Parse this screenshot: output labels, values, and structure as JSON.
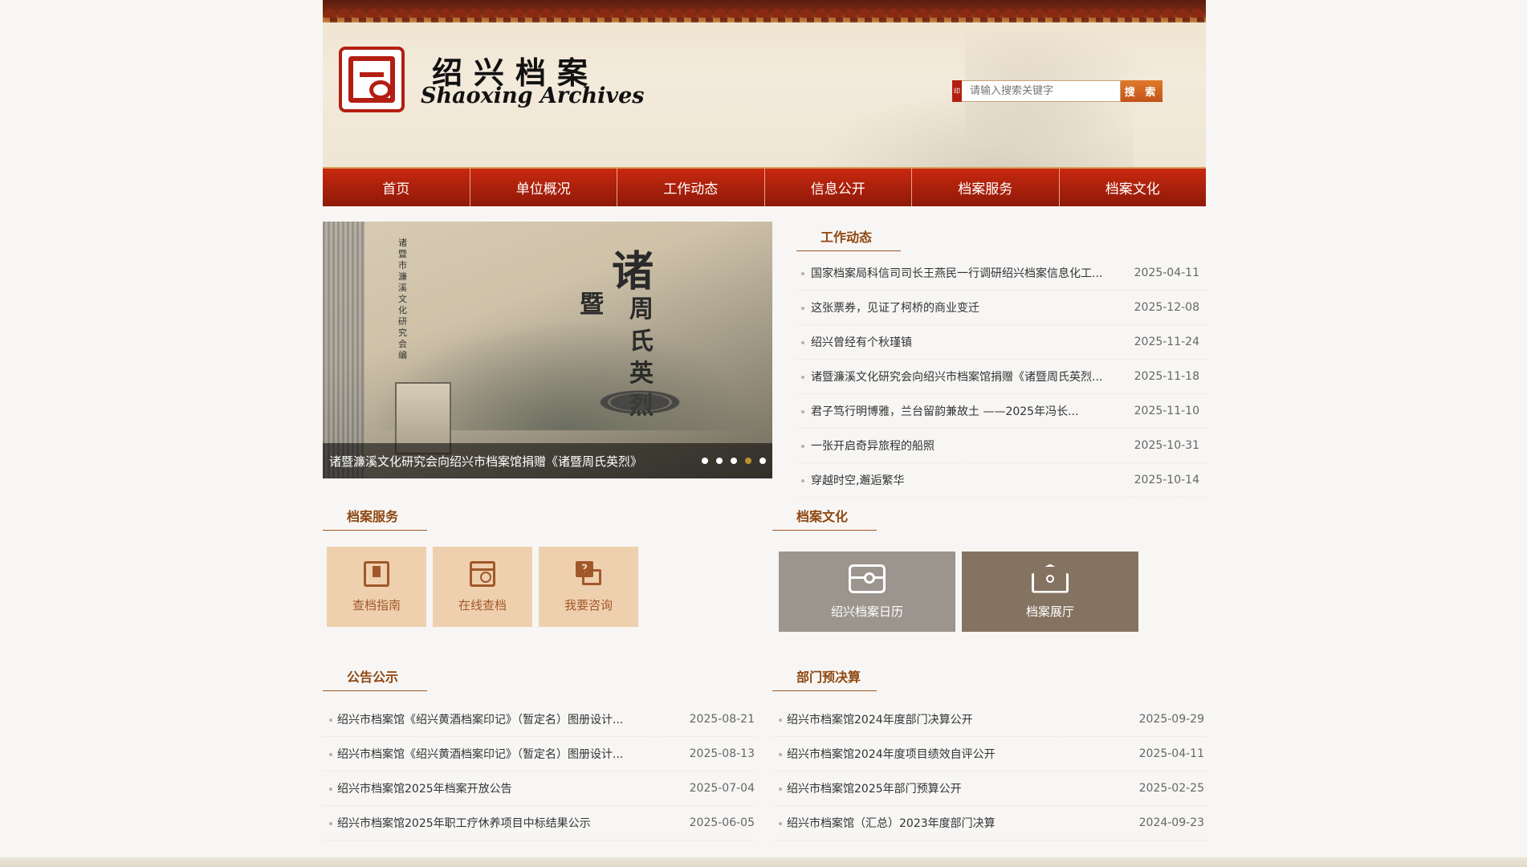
{
  "header": {
    "logo_cn": "绍兴档案",
    "logo_en": "Shaoxing Archives",
    "search_placeholder": "请输入搜索关键字",
    "search_button": "搜 索"
  },
  "nav": [
    {
      "label": "首页"
    },
    {
      "label": "单位概况"
    },
    {
      "label": "工作动态"
    },
    {
      "label": "信息公开"
    },
    {
      "label": "档案服务"
    },
    {
      "label": "档案文化"
    }
  ],
  "slider": {
    "caption": "诸暨濂溪文化研究会向绍兴市档案馆捐赠《诸暨周氏英烈》",
    "image_title_1": "诸",
    "image_title_2": "暨",
    "image_title_col": "周氏英烈",
    "image_side_text": "诸暨市濂溪文化研究会编",
    "dot_count": 5,
    "active_dot": 4
  },
  "news": {
    "title": "工作动态",
    "items": [
      {
        "title": "国家档案局科信司司长王燕民一行调研绍兴档案信息化工...",
        "date": "2025-04-11"
      },
      {
        "title": "这张票券，见证了柯桥的商业变迁",
        "date": "2025-12-08"
      },
      {
        "title": "绍兴曾经有个秋瑾镇",
        "date": "2025-11-24"
      },
      {
        "title": "诸暨濂溪文化研究会向绍兴市档案馆捐赠《诸暨周氏英烈...",
        "date": "2025-11-18"
      },
      {
        "title": "君子笃行明博雅，兰台留韵兼故土 ——2025年冯长...",
        "date": "2025-11-10"
      },
      {
        "title": "一张开启奇异旅程的船照",
        "date": "2025-10-31"
      },
      {
        "title": "穿越时空,邂逅繁华",
        "date": "2025-10-14"
      }
    ]
  },
  "services": {
    "title": "档案服务",
    "tiles": [
      {
        "label": "查档指南",
        "icon": "book-icon"
      },
      {
        "label": "在线查档",
        "icon": "calendar-search-icon"
      },
      {
        "label": "我要咨询",
        "icon": "chat-question-icon"
      }
    ]
  },
  "culture": {
    "title": "档案文化",
    "tiles": [
      {
        "label": "绍兴档案日历",
        "icon": "archive-box-icon"
      },
      {
        "label": "档案展厅",
        "icon": "tag-house-icon"
      }
    ]
  },
  "notices": {
    "title": "公告公示",
    "items": [
      {
        "title": "绍兴市档案馆《绍兴黄酒档案印记》（暂定名）图册设计...",
        "date": "2025-08-21"
      },
      {
        "title": "绍兴市档案馆《绍兴黄酒档案印记》（暂定名）图册设计...",
        "date": "2025-08-13"
      },
      {
        "title": "绍兴市档案馆2025年档案开放公告",
        "date": "2025-07-04"
      },
      {
        "title": "绍兴市档案馆2025年职工疗休养项目中标结果公示",
        "date": "2025-06-05"
      }
    ]
  },
  "budget": {
    "title": "部门预决算",
    "items": [
      {
        "title": "绍兴市档案馆2024年度部门决算公开",
        "date": "2025-09-29"
      },
      {
        "title": "绍兴市档案馆2024年度项目绩效自评公开",
        "date": "2025-04-11"
      },
      {
        "title": "绍兴市档案馆2025年部门预算公开",
        "date": "2025-02-25"
      },
      {
        "title": "绍兴市档案馆（汇总）2023年度部门决算",
        "date": "2024-09-23"
      }
    ]
  }
}
